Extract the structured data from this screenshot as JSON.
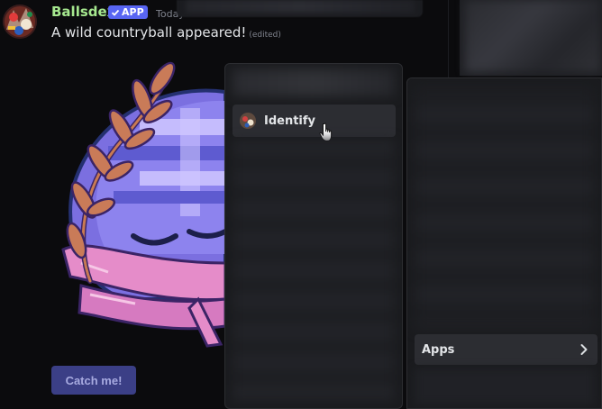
{
  "message": {
    "author": "Ballsdex",
    "badge": "APP",
    "timestamp": "Today",
    "text": "A wild countryball appeared!",
    "edited": "(edited)",
    "button": "Catch me!"
  },
  "context_menu": {
    "items": [
      {
        "label": "Identify",
        "icon": "app-avatar-icon",
        "hovered": true
      }
    ]
  },
  "submenu": {
    "items": [
      {
        "label": "Apps",
        "icon": "chevron-right-icon"
      }
    ]
  },
  "colors": {
    "author": "#a6e88f",
    "badge": "#5865f2",
    "button_bg": "#3b3f86",
    "menu_bg": "#1a1b1e",
    "menu_hover": "#2c2d32"
  }
}
